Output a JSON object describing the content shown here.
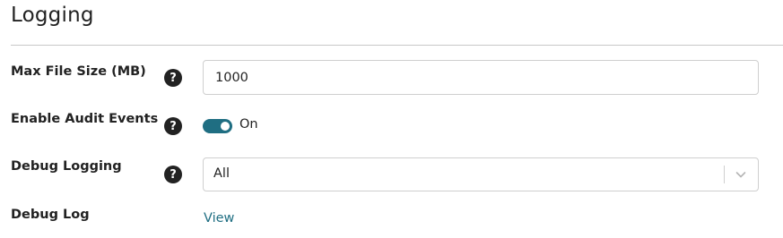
{
  "section": {
    "title": "Logging"
  },
  "fields": {
    "max_file_size": {
      "label": "Max File Size (MB)",
      "help_glyph": "?",
      "value": "1000"
    },
    "audit_events": {
      "label": "Enable Audit Events",
      "help_glyph": "?",
      "state_label": "On",
      "enabled": true
    },
    "debug_logging": {
      "label": "Debug Logging",
      "help_glyph": "?",
      "selected": "All"
    },
    "debug_log": {
      "label": "Debug Log",
      "link_text": "View"
    }
  },
  "colors": {
    "accent": "#1f6e82",
    "text": "#222222",
    "border": "#cfcfcf",
    "help_bg": "#222222"
  },
  "icons": {
    "help": "question-circle-icon",
    "select_arrow": "chevron-down-icon"
  }
}
